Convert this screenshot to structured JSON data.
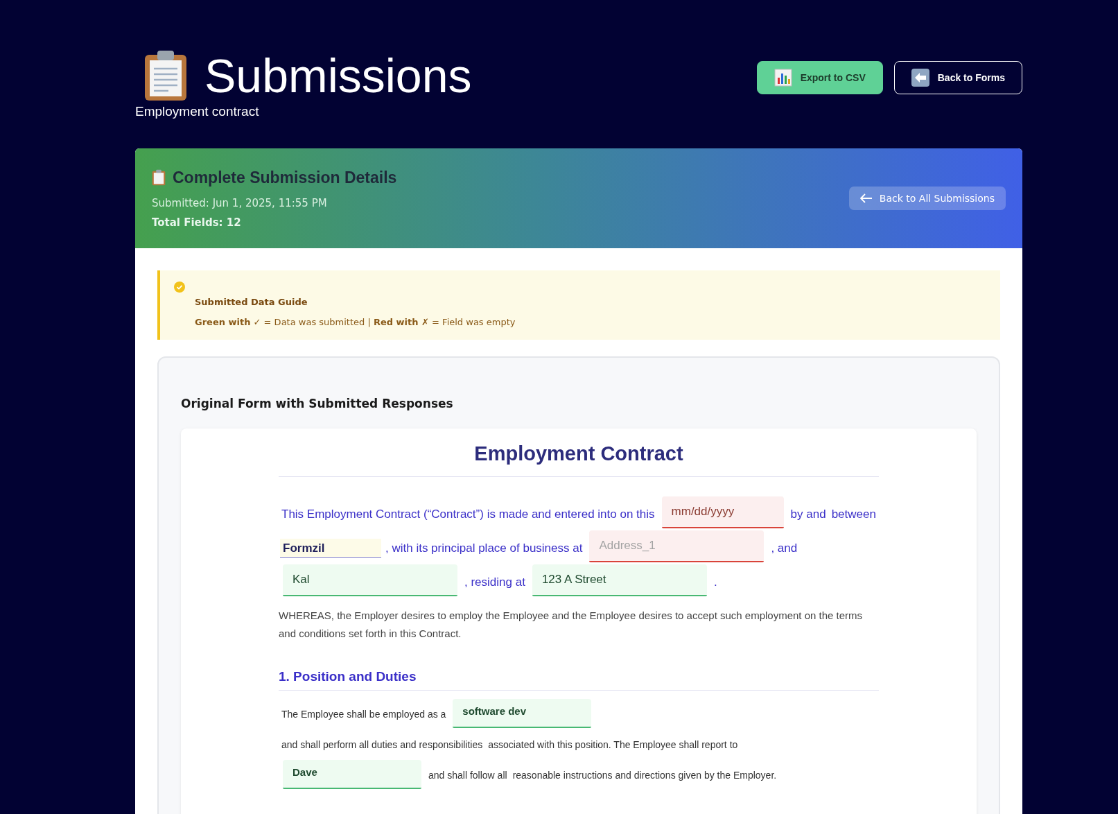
{
  "header": {
    "title": "Submissions",
    "subtitle": "Employment contract",
    "buttons": [
      {
        "label": "Export to CSV",
        "kind": "export"
      },
      {
        "label": "Back to Forms",
        "kind": "back"
      }
    ]
  },
  "details": {
    "title": "Complete Submission Details",
    "submitted": "Submitted: Jun 1, 2025, 11:55 PM",
    "total_fields": "Total Fields: 12",
    "back_button": "Back to All Submissions"
  },
  "guide": {
    "title": "Submitted Data Guide",
    "legend": "**Green with** ✓ = Data was submitted | **Red with ✗** = Field was empty"
  },
  "form_panel": {
    "title": "Original Form with Submitted Responses",
    "document": {
      "title": "Employment Contract",
      "intro": [
        {
          "kind": "text",
          "text": "This Employment Contract (“Contract”) is made and entered into on this"
        },
        {
          "kind": "date_field",
          "submitted": false,
          "placeholder": "mm/dd/yyyy"
        },
        {
          "kind": "text",
          "text": "by and"
        },
        {
          "kind": "text",
          "text": "between"
        },
        {
          "kind": "company_field",
          "value": "Formzil"
        },
        {
          "kind": "text",
          "text": ", with its principal place of business at"
        },
        {
          "kind": "text_field",
          "submitted": false,
          "placeholder": "Address_1"
        },
        {
          "kind": "text",
          "text": ", and"
        },
        {
          "kind": "text_field",
          "submitted": true,
          "value": "Kal"
        },
        {
          "kind": "text",
          "text": ", residing at"
        },
        {
          "kind": "text_field",
          "submitted": true,
          "value": "123 A Street"
        },
        {
          "kind": "text",
          "text": "."
        }
      ],
      "whereas": "WHEREAS, the Employer desires to employ the Employee and the Employee desires to accept such employment on the terms and conditions set forth in this Contract.",
      "sections": [
        {
          "heading": "1. Position and Duties",
          "parts": [
            {
              "kind": "text",
              "text": "The Employee shall be employed as a"
            },
            {
              "kind": "short_field",
              "submitted": true,
              "value": "software dev"
            },
            {
              "kind": "text",
              "text": "and shall perform all duties and responsibilities"
            },
            {
              "kind": "text",
              "text": "associated with this position. The Employee shall report to"
            },
            {
              "kind": "short_field",
              "submitted": true,
              "value": "Dave"
            },
            {
              "kind": "text",
              "text": "and shall follow all"
            },
            {
              "kind": "text",
              "text": "reasonable instructions and directions given by the Employer."
            }
          ]
        }
      ]
    }
  }
}
